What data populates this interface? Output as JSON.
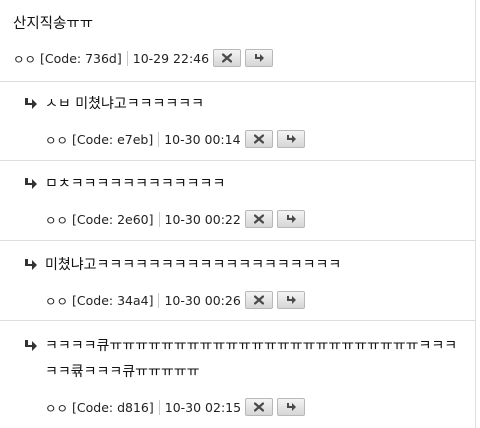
{
  "root": {
    "text": "산지직송ㅠㅠ",
    "author": "ㅇㅇ",
    "code": "[Code: 736d]",
    "time": "10-29 22:46"
  },
  "replies": [
    {
      "text": "ㅅㅂ 미쳤냐고ㅋㅋㅋㅋㅋㅋ",
      "author": "ㅇㅇ",
      "code": "[Code: e7eb]",
      "time": "10-30 00:14"
    },
    {
      "text": "ㅁㅊㅋㅋㅋㅋㅋㅋㅋㅋㅋㅋㅋㅋ",
      "author": "ㅇㅇ",
      "code": "[Code: 2e60]",
      "time": "10-30 00:22"
    },
    {
      "text": "미쳤냐고ㅋㅋㅋㅋㅋㅋㅋㅋㅋㅋㅋㅋㅋㅋㅋㅋㅋㅋㅋ",
      "author": "ㅇㅇ",
      "code": "[Code: 34a4]",
      "time": "10-30 00:26"
    },
    {
      "text": "ㅋㅋㅋㅋ큐ㅠㅠㅠㅠㅠㅠㅠㅠㅠㅠㅠㅠㅠㅠㅠㅠㅠㅠㅠㅠㅠㅠㅠㅠㅋㅋㅋㅋㅋ큒ㅋㅋㅋ큐ㅠㅠㅠㅠㅠ",
      "author": "ㅇㅇ",
      "code": "[Code: d816]",
      "time": "10-30 02:15"
    }
  ],
  "icons": {
    "reply_arrow": "reply-arrow-icon",
    "delete_button": "close-icon",
    "reply_button": "reply-arrow-icon"
  },
  "colors": {
    "divider": "#dddddd",
    "button_border": "#b8b8b8",
    "icon_fill": "#4a4a4a"
  }
}
